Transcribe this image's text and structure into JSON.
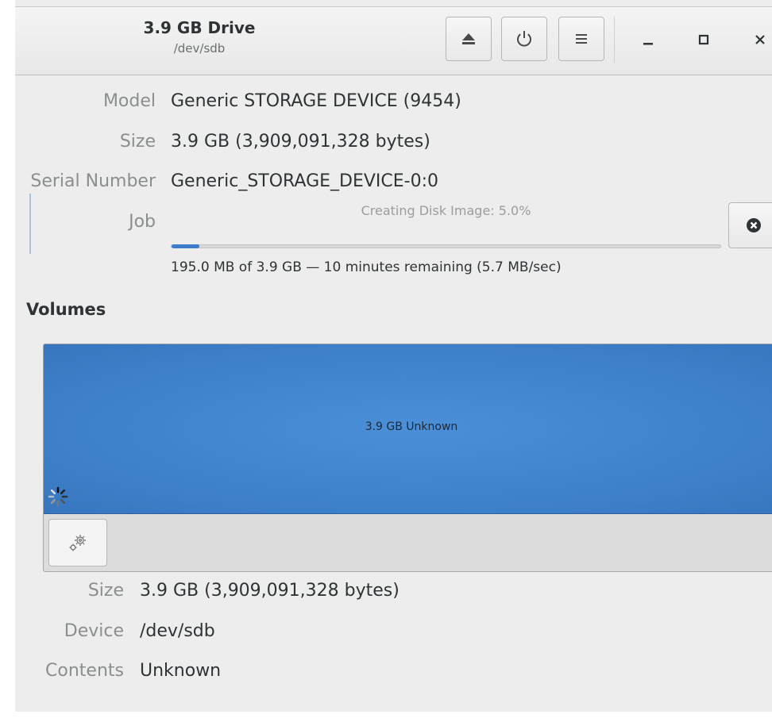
{
  "header": {
    "title": "3.9 GB Drive",
    "subtitle": "/dev/sdb",
    "buttons": {
      "eject_icon": "eject-icon",
      "power_icon": "power-icon",
      "menu_icon": "hamburger-menu-icon"
    },
    "window_controls": {
      "minimize": "_",
      "maximize": "□",
      "close": "×"
    }
  },
  "drive_info": {
    "model_label": "Model",
    "model_value": "Generic STORAGE DEVICE (9454)",
    "size_label": "Size",
    "size_value": "3.9 GB (3,909,091,328 bytes)",
    "serial_label": "Serial Number",
    "serial_value": "Generic_STORAGE_DEVICE-0:0",
    "job_label": "Job",
    "job_caption": "Creating Disk Image: 5.0%",
    "job_progress": 0.05,
    "job_detail": "195.0 MB of 3.9 GB — 10 minutes remaining (5.7 MB/sec)",
    "cancel_icon": "cancel-circle-icon"
  },
  "volumes": {
    "title": "Volumes",
    "partition_label": "3.9 GB Unknown",
    "partition_color": "#4289d3",
    "busy_icon": "spinner-icon",
    "settings_icon": "gears-icon"
  },
  "volume_info": {
    "size_label": "Size",
    "size_value": "3.9 GB (3,909,091,328 bytes)",
    "device_label": "Device",
    "device_value": "/dev/sdb",
    "contents_label": "Contents",
    "contents_value": "Unknown"
  }
}
